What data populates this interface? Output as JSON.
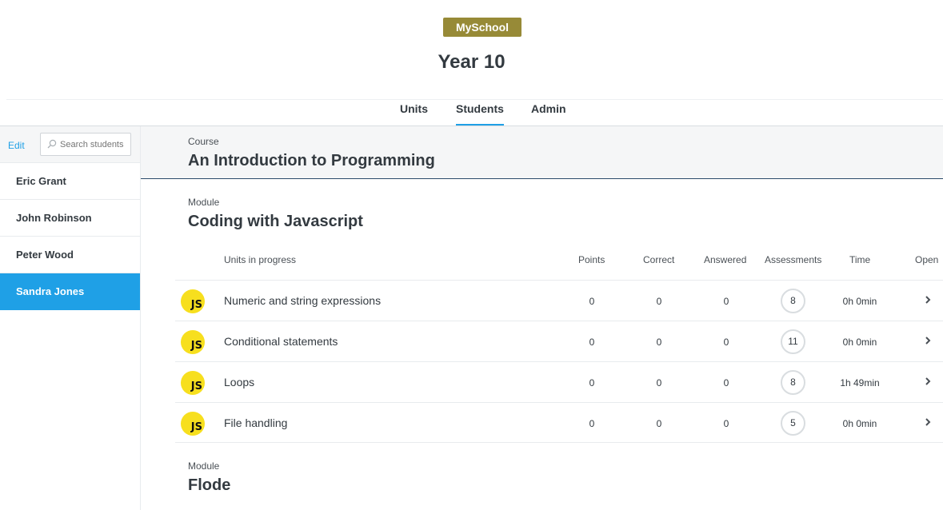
{
  "header": {
    "brand": "MySchool",
    "title": "Year 10",
    "tabs": [
      "Units",
      "Students",
      "Admin"
    ],
    "active_tab": "Students"
  },
  "sidebar": {
    "edit_label": "Edit",
    "search_placeholder": "Search students",
    "students": [
      "Eric Grant",
      "John Robinson",
      "Peter Wood",
      "Sandra Jones"
    ],
    "active_student": "Sandra Jones"
  },
  "course": {
    "label": "Course",
    "name": "An Introduction to Programming"
  },
  "modules": [
    {
      "label": "Module",
      "name": "Coding with Javascript",
      "table": {
        "headers": [
          "Units in progress",
          "Points",
          "Correct",
          "Answered",
          "Assessments",
          "Time",
          "Open"
        ],
        "rows": [
          {
            "icon": "JS",
            "unit": "Numeric and string expressions",
            "points": "0",
            "correct": "0",
            "answered": "0",
            "assessments": "8",
            "time": "0h 0min"
          },
          {
            "icon": "JS",
            "unit": "Conditional statements",
            "points": "0",
            "correct": "0",
            "answered": "0",
            "assessments": "11",
            "time": "0h 0min"
          },
          {
            "icon": "JS",
            "unit": "Loops",
            "points": "0",
            "correct": "0",
            "answered": "0",
            "assessments": "8",
            "time": "1h 49min"
          },
          {
            "icon": "JS",
            "unit": "File handling",
            "points": "0",
            "correct": "0",
            "answered": "0",
            "assessments": "5",
            "time": "0h 0min"
          }
        ]
      }
    },
    {
      "label": "Module",
      "name": "Flode"
    }
  ],
  "colors": {
    "brand": "#978a37",
    "accent": "#1fa0e6",
    "js_badge": "#f7df1e"
  },
  "icons": [
    "search-icon",
    "chevron-right-icon",
    "js-icon"
  ]
}
